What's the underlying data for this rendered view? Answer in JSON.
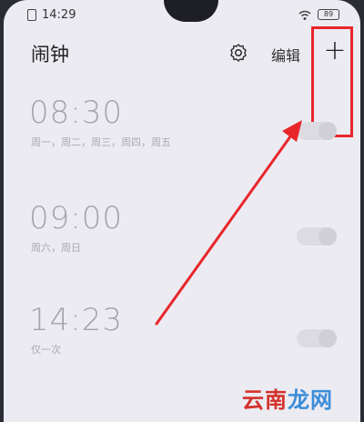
{
  "status_bar": {
    "time": "14:29",
    "battery": "89"
  },
  "header": {
    "title": "闹钟",
    "edit_label": "编辑",
    "add_label": "+"
  },
  "alarms": [
    {
      "time": "08:30",
      "repeat": "周一，周二，周三，周四，周五",
      "enabled": false
    },
    {
      "time": "09:00",
      "repeat": "周六，周日",
      "enabled": false
    },
    {
      "time": "14:23",
      "repeat": "仅一次",
      "enabled": false
    }
  ],
  "annotation": {
    "highlight_color": "#e8262a",
    "arrow_color": "#e8262a"
  },
  "watermark": {
    "part1": "云南",
    "part2": "龙网"
  }
}
